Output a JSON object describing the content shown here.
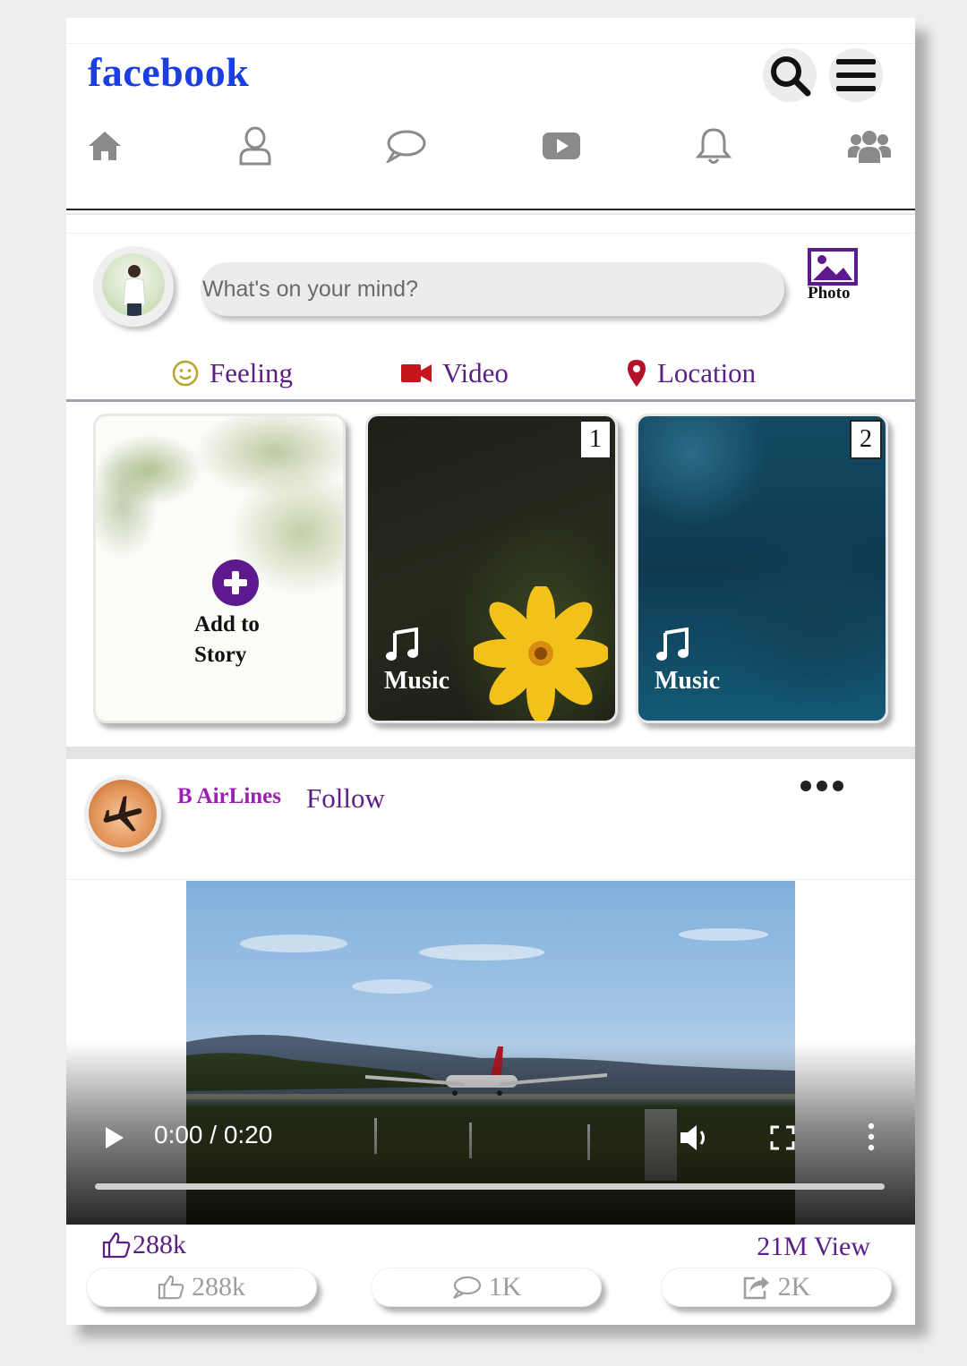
{
  "header": {
    "brand": "facebook",
    "nav": [
      "home-icon",
      "user-icon",
      "chat-icon",
      "video-icon",
      "bell-icon",
      "group-icon"
    ]
  },
  "composer": {
    "placeholder": "What's on your mind?",
    "photo_label": "Photo",
    "actions": [
      {
        "label": "Feeling",
        "icon": "smiley-icon"
      },
      {
        "label": "Video",
        "icon": "video-camera-icon"
      },
      {
        "label": "Location",
        "icon": "map-pin-icon"
      }
    ]
  },
  "stories": {
    "add_label_line1": "Add to",
    "add_label_line2": "Story",
    "items": [
      {
        "badge": "1",
        "label": "Music"
      },
      {
        "badge": "2",
        "label": "Music"
      }
    ]
  },
  "post": {
    "page_name": "B AirLines",
    "follow_label": "Follow",
    "video": {
      "time": "0:00 / 0:20",
      "progress": 0
    },
    "likes": "288k",
    "views": "21M View",
    "buttons": {
      "like": "288k",
      "comment": "1K",
      "share": "2K"
    }
  },
  "colors": {
    "brand": "#1b3ee0",
    "accent_purple": "#5b1e86",
    "page_name": "#9b1fb2",
    "video_icon": "#c4161c",
    "location_icon": "#b5122a"
  }
}
